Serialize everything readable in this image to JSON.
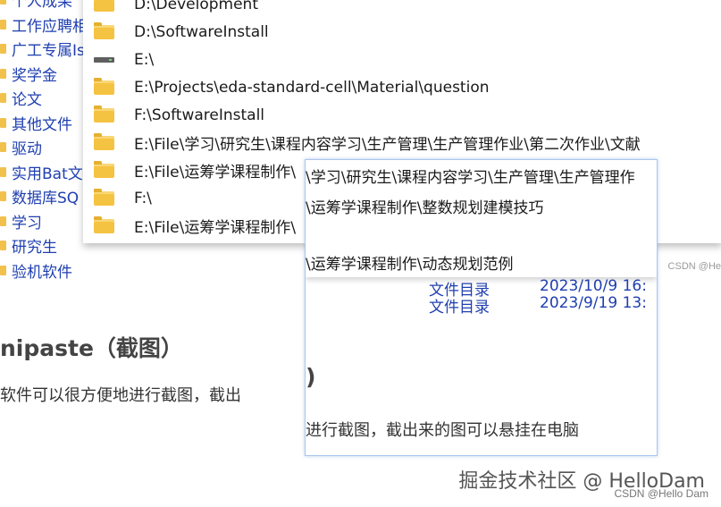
{
  "tree": {
    "items": [
      "个人成果",
      "工作应聘相",
      "广工专属Is",
      "奖学金",
      "论文",
      "其他文件",
      "驱动",
      "实用Bat文",
      "数据库SQ",
      "学习",
      "研究生",
      "验机软件"
    ]
  },
  "background": {
    "heading": "nipaste（截图）",
    "body": "软件可以很方便地进行截图，截出",
    "watermark_right": "CSDN @He",
    "watermark_big": "掘金技术社区 @ HelloDam",
    "watermark_small": "CSDN @Hello Dam"
  },
  "history": {
    "rows": [
      {
        "icon": "folder-icon",
        "path": "D:\\Development"
      },
      {
        "icon": "folder-icon",
        "path": "D:\\SoftwareInstall"
      },
      {
        "icon": "drive-icon",
        "path": "E:\\"
      },
      {
        "icon": "folder-icon",
        "path": "E:\\Projects\\eda-standard-cell\\Material\\question"
      },
      {
        "icon": "folder-icon",
        "path": "F:\\SoftwareInstall"
      },
      {
        "icon": "folder-icon",
        "path": "E:\\File\\学习\\研究生\\课程内容学习\\生产管理\\生产管理作业\\第二次作业\\文献"
      },
      {
        "icon": "folder-icon",
        "path": "E:\\File\\运筹学课程制作\\"
      },
      {
        "icon": "folder-icon",
        "path": "F:\\"
      },
      {
        "icon": "folder-icon",
        "path": "E:\\File\\运筹学课程制作\\"
      }
    ]
  },
  "popup": {
    "lines": [
      "\\学习\\研究生\\课程内容学习\\生产管理\\生产管理作",
      "\\运筹学课程制作\\整数规划建模技巧",
      "\\运筹学课程制作\\动态规划范例"
    ],
    "files": [
      {
        "type": "文件目录",
        "date": "2023/10/9  16:"
      },
      {
        "type": "文件目录",
        "date": "2023/9/19  13:"
      }
    ],
    "heading": ")",
    "body": "进行截图，截出来的图可以悬挂在电脑"
  }
}
